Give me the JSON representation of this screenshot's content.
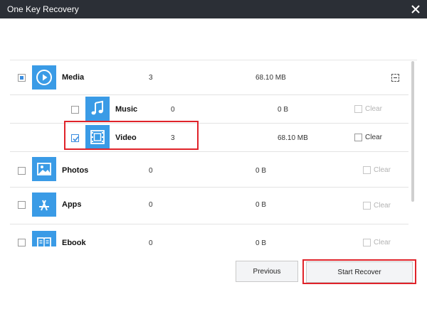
{
  "window": {
    "title": "One Key Recovery"
  },
  "rows": [
    {
      "label": "Media",
      "count": "3",
      "size": "68.10 MB"
    },
    {
      "label": "Music",
      "count": "0",
      "size": "0 B",
      "clear": "Clear"
    },
    {
      "label": "Video",
      "count": "3",
      "size": "68.10 MB",
      "clear": "Clear"
    },
    {
      "label": "Photos",
      "count": "0",
      "size": "0 B",
      "clear": "Clear"
    },
    {
      "label": "Apps",
      "count": "0",
      "size": "0 B",
      "clear": "Clear"
    },
    {
      "label": "Ebook",
      "count": "0",
      "size": "0 B",
      "clear": "Clear"
    }
  ],
  "buttons": {
    "previous": "Previous",
    "start_recover": "Start Recover"
  },
  "colors": {
    "accent": "#3a9be6",
    "highlight": "#e0232a",
    "titlebar": "#2b2f36"
  },
  "icons": {
    "media": "play-circle-icon",
    "music": "music-note-icon",
    "video": "film-icon",
    "photos": "photo-icon",
    "apps": "app-store-icon",
    "ebook": "book-icon",
    "close": "close-icon"
  }
}
